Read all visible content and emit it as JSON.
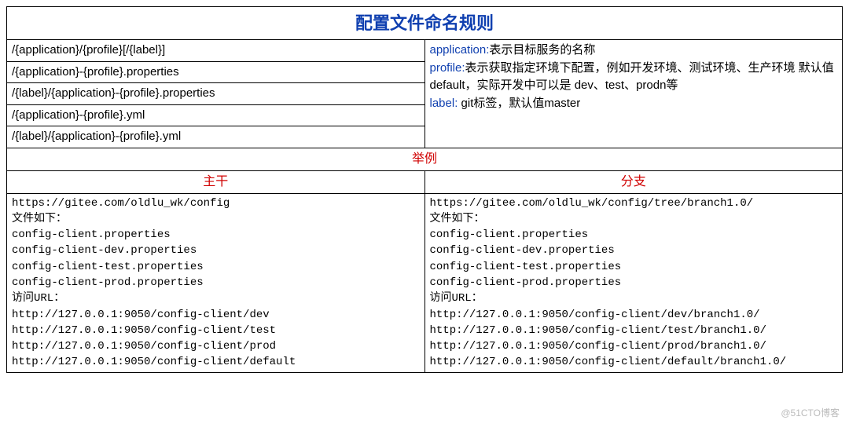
{
  "title": "配置文件命名规则",
  "patterns": [
    "/{application}/{profile}[/{label}]",
    "/{application}-{profile}.properties",
    "/{label}/{application}-{profile}.properties",
    "/{application}-{profile}.yml",
    "/{label}/{application}-{profile}.yml"
  ],
  "desc": {
    "application_term": "application:",
    "application_text": "表示目标服务的名称",
    "profile_term": "profile:",
    "profile_text": "表示获取指定环境下配置，例如开发环境、测试环境、生产环境 默认值default，实际开发中可以是 dev、test、prodn等",
    "label_term": "label:",
    "label_text": " git标签，默认值master"
  },
  "example_header": "举例",
  "trunk_header": "主干",
  "branch_header": "分支",
  "trunk_body": "https://gitee.com/oldlu_wk/config\n文件如下：\nconfig-client.properties\nconfig-client-dev.properties\nconfig-client-test.properties\nconfig-client-prod.properties\n访问URL：\nhttp://127.0.0.1:9050/config-client/dev\nhttp://127.0.0.1:9050/config-client/test\nhttp://127.0.0.1:9050/config-client/prod\nhttp://127.0.0.1:9050/config-client/default",
  "branch_body": "https://gitee.com/oldlu_wk/config/tree/branch1.0/\n文件如下：\nconfig-client.properties\nconfig-client-dev.properties\nconfig-client-test.properties\nconfig-client-prod.properties\n访问URL：\nhttp://127.0.0.1:9050/config-client/dev/branch1.0/\nhttp://127.0.0.1:9050/config-client/test/branch1.0/\nhttp://127.0.0.1:9050/config-client/prod/branch1.0/\nhttp://127.0.0.1:9050/config-client/default/branch1.0/",
  "watermark": "@51CTO博客"
}
